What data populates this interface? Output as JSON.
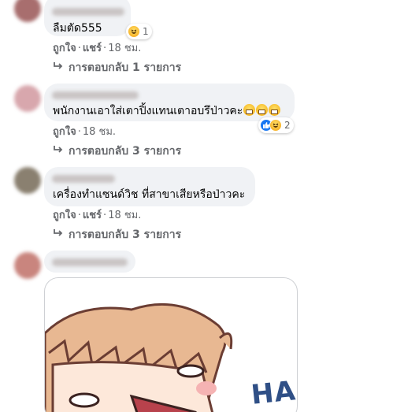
{
  "comments": [
    {
      "text": "ลืมตัด555",
      "actions": {
        "like": "ถูกใจ",
        "reply": "แชร์",
        "time": "18 ชม."
      },
      "reaction_count": "1",
      "replies": "การตอบกลับ 1 รายการ"
    },
    {
      "text": "พนักงานเอาใส่เตาปิ้งแทนเตาอบรึป่าวคะ",
      "actions": {
        "like": "ถูกใจ",
        "time": "18 ชม."
      },
      "reaction_count": "2",
      "replies": "การตอบกลับ 3 รายการ"
    },
    {
      "text": "เครื่องทำแซนด์วิช ที่สาขาเสียหรือป่าวคะ",
      "actions": {
        "like": "ถูกใจ",
        "reply": "แชร์",
        "time": "18 ชม."
      },
      "replies": "การตอบกลับ 3 รายการ"
    }
  ],
  "sticker": {
    "caption": "HA"
  },
  "colors": {
    "bubble": "#f0f2f5",
    "meta_text": "#65676b",
    "like_blue": "#1877f2",
    "haha_yellow": "#f7b125"
  },
  "icons": {
    "reply_arrow": "reply-arrow-icon",
    "haha": "haha-reaction-icon",
    "like": "like-reaction-icon"
  }
}
